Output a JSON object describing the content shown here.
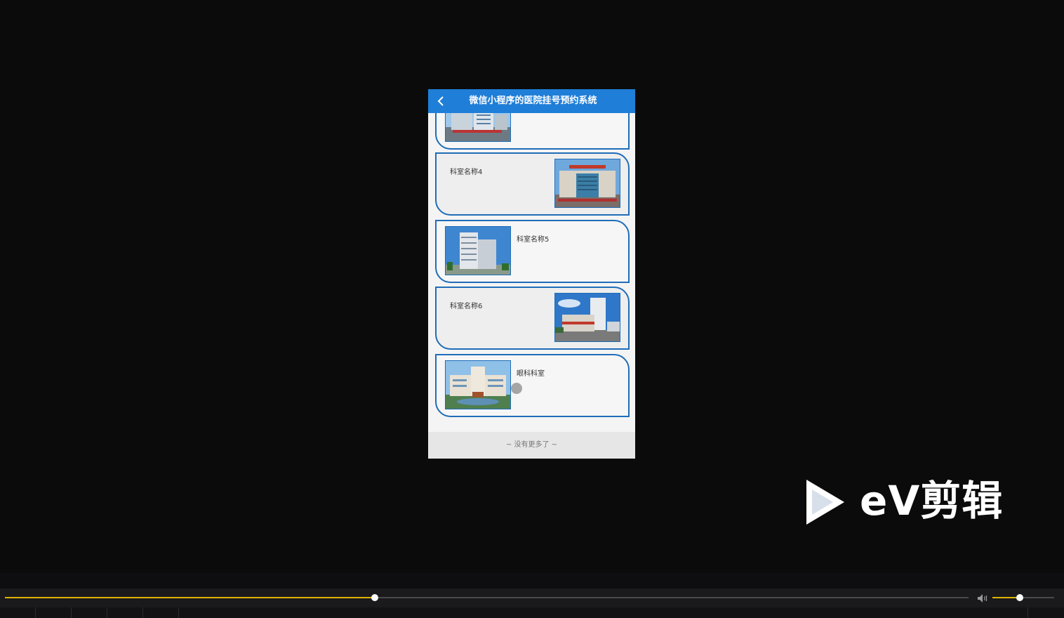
{
  "phone": {
    "title": "微信小程序的医院挂号预约系统",
    "back_icon": "chevron-left-icon",
    "header_color": "#1f7ed8"
  },
  "departments": [
    {
      "name": "",
      "image_side": "left",
      "image": "hospital-photo-1"
    },
    {
      "name": "科室名称4",
      "image_side": "right",
      "image": "hospital-photo-2"
    },
    {
      "name": "科室名称5",
      "image_side": "left",
      "image": "hospital-photo-3"
    },
    {
      "name": "科室名称6",
      "image_side": "right",
      "image": "hospital-photo-4"
    },
    {
      "name": "眼科科室",
      "image_side": "left",
      "image": "hospital-photo-5"
    }
  ],
  "footer": {
    "text": "~ 没有更多了 ~"
  },
  "watermark": {
    "text": "eV剪辑",
    "icon": "play-logo-icon"
  },
  "player": {
    "progress": 0.384,
    "volume": 0.44,
    "accent": "#e0b400",
    "volume_icon": "speaker-icon"
  }
}
